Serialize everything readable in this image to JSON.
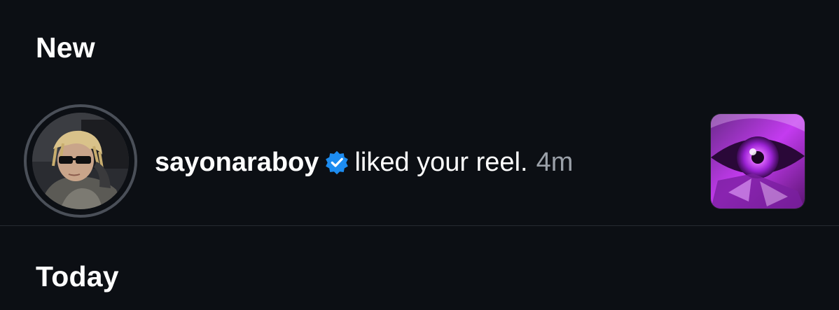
{
  "sections": {
    "new_title": "New",
    "today_title": "Today"
  },
  "notification": {
    "username": "sayonaraboy",
    "verified": true,
    "action": "liked your reel.",
    "time": "4m",
    "avatar_icon": "user-avatar",
    "thumbnail_icon": "reel-thumbnail"
  },
  "colors": {
    "background": "#0c0f14",
    "verified_badge": "#1d8cf0",
    "timestamp": "#9aa0a8",
    "thumbnail_accent": "#c43bf0"
  }
}
